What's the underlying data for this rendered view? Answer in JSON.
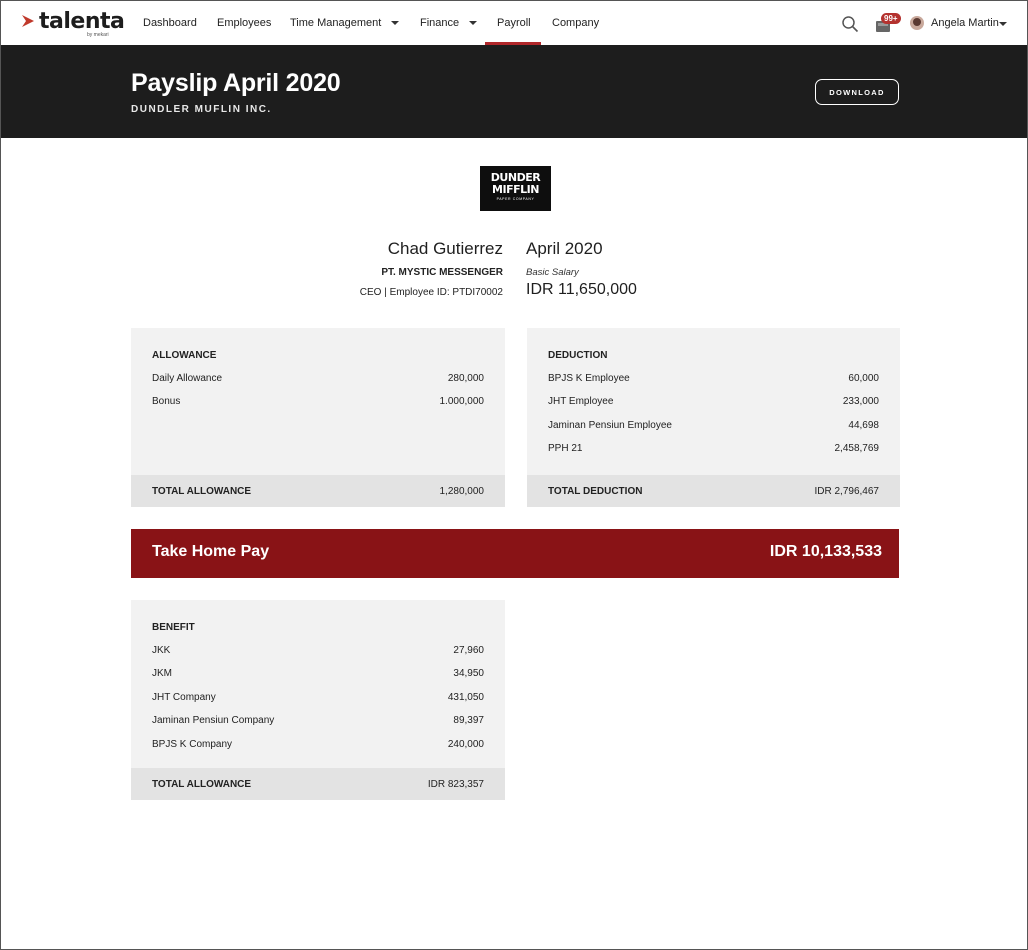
{
  "nav": {
    "logo_text": "talenta",
    "logo_sub": "by mekari",
    "items": [
      {
        "label": "Dashboard"
      },
      {
        "label": "Employees"
      },
      {
        "label": "Time Management"
      },
      {
        "label": "Finance"
      },
      {
        "label": "Payroll"
      },
      {
        "label": "Company"
      }
    ],
    "active_item": "Payroll",
    "notification_badge": "99+",
    "user_name": "Angela Martin",
    "accent_color": "#b0272a"
  },
  "header": {
    "title": "Payslip April 2020",
    "company": "DUNDLER MUFLIN INC.",
    "download_label": "DOWNLOAD"
  },
  "company_logo": {
    "line1": "DUNDER",
    "line2": "MIFFLIN",
    "line3": "PAPER COMPANY"
  },
  "employee": {
    "name": "Chad Gutierrez",
    "company": "PT. MYSTIC MESSENGER",
    "role_id": "CEO | Employee ID: PTDI70002"
  },
  "period": {
    "label": "April 2020",
    "basic_salary_label": "Basic Salary",
    "basic_salary_value": "IDR 11,650,000"
  },
  "allowance": {
    "title": "ALLOWANCE",
    "items": [
      {
        "name": "Daily Allowance",
        "value": "280,000"
      },
      {
        "name": "Bonus",
        "value": "1.000,000"
      }
    ],
    "total_label": "TOTAL ALLOWANCE",
    "total_value": "1,280,000"
  },
  "deduction": {
    "title": "DEDUCTION",
    "items": [
      {
        "name": "BPJS K Employee",
        "value": "60,000"
      },
      {
        "name": "JHT Employee",
        "value": "233,000"
      },
      {
        "name": "Jaminan Pensiun Employee",
        "value": "44,698"
      },
      {
        "name": "PPH 21",
        "value": "2,458,769"
      }
    ],
    "total_label": "TOTAL DEDUCTION",
    "total_value": "IDR 2,796,467"
  },
  "take_home": {
    "label": "Take Home Pay",
    "value": "IDR 10,133,533",
    "color": "#891316"
  },
  "benefit": {
    "title": "BENEFIT",
    "items": [
      {
        "name": "JKK",
        "value": "27,960"
      },
      {
        "name": "JKM",
        "value": "34,950"
      },
      {
        "name": "JHT Company",
        "value": "431,050"
      },
      {
        "name": "Jaminan Pensiun Company",
        "value": "89,397"
      },
      {
        "name": "BPJS K Company",
        "value": "240,000"
      }
    ],
    "total_label": "TOTAL ALLOWANCE",
    "total_value": "IDR 823,357"
  }
}
